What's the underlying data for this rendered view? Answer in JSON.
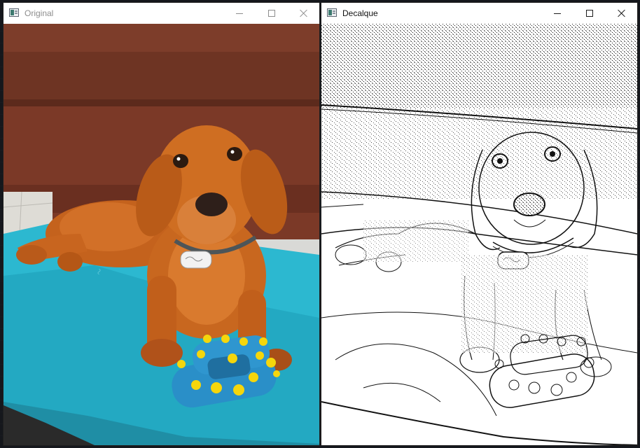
{
  "windows": [
    {
      "title": "Original",
      "state": "inactive",
      "image": "photo-dachshund-on-cyan-bed",
      "icons": [
        "app-icon",
        "minimize-icon",
        "maximize-icon",
        "close-icon"
      ]
    },
    {
      "title": "Decalque",
      "state": "active",
      "image": "pencil-sketch-dachshund",
      "icons": [
        "app-icon",
        "minimize-icon",
        "maximize-icon",
        "close-icon"
      ]
    }
  ],
  "colors": {
    "sofa": "#7a3a26",
    "dog": "#c7651f",
    "bed": "#28b4cc",
    "toy_blue": "#2a8fc8",
    "toy_yellow": "#f5d60c",
    "sketch_ink": "#111111"
  }
}
